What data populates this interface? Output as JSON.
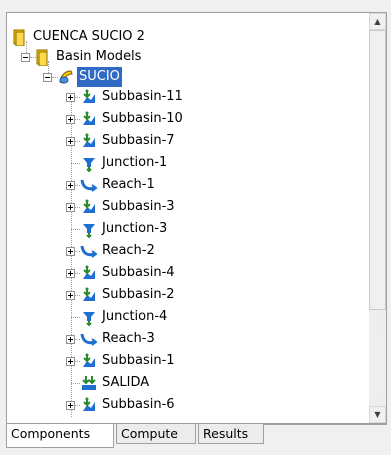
{
  "tree": {
    "root": {
      "label": "CUENCA SUCIO 2",
      "icon": "project-folder-icon"
    },
    "basin_models": {
      "label": "Basin Models",
      "icon": "folder-icon"
    },
    "selected_basin": {
      "label": "SUCIO",
      "icon": "basin-model-icon"
    },
    "elements": [
      {
        "label": "Subbasin-11",
        "icon": "subbasin-icon",
        "expandable": true
      },
      {
        "label": "Subbasin-10",
        "icon": "subbasin-icon",
        "expandable": true
      },
      {
        "label": "Subbasin-7",
        "icon": "subbasin-icon",
        "expandable": true
      },
      {
        "label": "Junction-1",
        "icon": "junction-icon",
        "expandable": false
      },
      {
        "label": "Reach-1",
        "icon": "reach-icon",
        "expandable": true
      },
      {
        "label": "Subbasin-3",
        "icon": "subbasin-icon",
        "expandable": true
      },
      {
        "label": "Junction-3",
        "icon": "junction-icon",
        "expandable": false
      },
      {
        "label": "Reach-2",
        "icon": "reach-icon",
        "expandable": true
      },
      {
        "label": "Subbasin-4",
        "icon": "subbasin-icon",
        "expandable": true
      },
      {
        "label": "Subbasin-2",
        "icon": "subbasin-icon",
        "expandable": true
      },
      {
        "label": "Junction-4",
        "icon": "junction-icon",
        "expandable": false
      },
      {
        "label": "Reach-3",
        "icon": "reach-icon",
        "expandable": true
      },
      {
        "label": "Subbasin-1",
        "icon": "subbasin-icon",
        "expandable": true
      },
      {
        "label": "SALIDA",
        "icon": "sink-icon",
        "expandable": false
      },
      {
        "label": "Subbasin-6",
        "icon": "subbasin-icon",
        "expandable": true
      }
    ]
  },
  "tabs": [
    {
      "label": "Components",
      "active": true
    },
    {
      "label": "Compute",
      "active": false
    },
    {
      "label": "Results",
      "active": false
    }
  ],
  "colors": {
    "selection": "#316ac5",
    "folder": "#f7c800",
    "water": "#1f6fd1"
  }
}
